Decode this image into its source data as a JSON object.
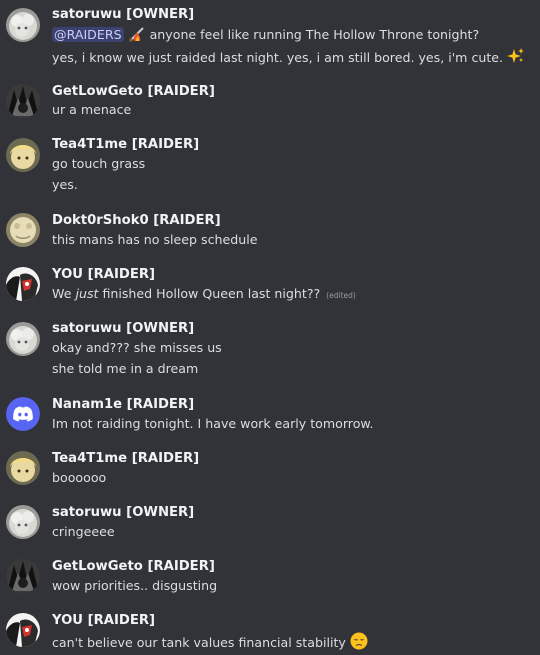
{
  "messages": [
    {
      "avatar": "white-fluffy-avatar",
      "author": "satoruwu [OWNER]",
      "lines": [
        {
          "mention": "@RAIDERS",
          "emoji": "flame-sword-emoji",
          "text": " anyone feel like running The Hollow Throne tonight?"
        },
        {
          "text": "yes, i know we just raided last night. yes, i am still bored. yes, i'm cute. ",
          "emoji": "sparkles-emoji"
        }
      ]
    },
    {
      "avatar": "dark-spiky-avatar",
      "author": "GetLowGeto [RAIDER]",
      "lines": [
        {
          "text": "ur a menace"
        }
      ]
    },
    {
      "avatar": "blonde-character-avatar",
      "author": "Tea4T1me [RAIDER]",
      "lines": [
        {
          "text": "go touch grass"
        },
        {
          "text": "yes."
        }
      ]
    },
    {
      "avatar": "pale-creature-avatar",
      "author": "Dokt0rShok0 [RAIDER]",
      "lines": [
        {
          "text": "this mans has no sleep schedule"
        }
      ]
    },
    {
      "avatar": "red-white-character-avatar",
      "author": "YOU [RAIDER]",
      "lines": [
        {
          "pre": "We ",
          "em": "just",
          "text": " finished Hollow Queen last night??",
          "edited": "(edited)"
        }
      ]
    },
    {
      "avatar": "white-fluffy-avatar",
      "author": "satoruwu [OWNER]",
      "lines": [
        {
          "text": "okay and??? she misses us"
        },
        {
          "text": "she told me in a dream"
        }
      ]
    },
    {
      "avatar": "discord-default-avatar",
      "author": "Nanam1e [RAIDER]",
      "lines": [
        {
          "text": "Im not raiding tonight. I have work early tomorrow."
        }
      ]
    },
    {
      "avatar": "blonde-character-avatar",
      "author": "Tea4T1me [RAIDER]",
      "lines": [
        {
          "text": "boooooo"
        }
      ]
    },
    {
      "avatar": "white-fluffy-avatar",
      "author": "satoruwu [OWNER]",
      "lines": [
        {
          "text": "cringeeee"
        }
      ]
    },
    {
      "avatar": "dark-spiky-avatar",
      "author": "GetLowGeto [RAIDER]",
      "lines": [
        {
          "text": "wow priorities.. disgusting"
        }
      ]
    },
    {
      "avatar": "red-white-character-avatar",
      "author": "YOU [RAIDER]",
      "lines": [
        {
          "text": "can't believe our tank values financial stability ",
          "emoji": "disappointed-face-emoji"
        }
      ]
    }
  ],
  "colors": {
    "background": "#313338",
    "author": "#f2f3f5",
    "text": "#dbdee1",
    "mention_bg": "#3c4270",
    "mention_text": "#c9cdfb",
    "discord_blurple": "#5865f2"
  }
}
